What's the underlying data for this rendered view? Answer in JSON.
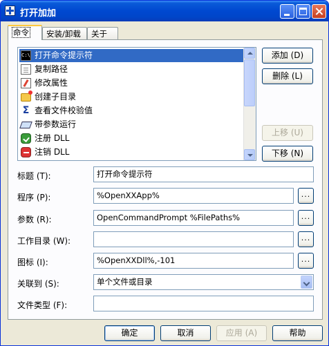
{
  "window": {
    "title": "打开加加"
  },
  "tabs": [
    {
      "label": "命令"
    },
    {
      "label": "安装/卸载"
    },
    {
      "label": "关于"
    }
  ],
  "command_list": {
    "items": [
      {
        "label": "打开命令提示符",
        "icon": "command-prompt-icon",
        "selected": true
      },
      {
        "label": "复制路径",
        "icon": "copy-path-icon"
      },
      {
        "label": "修改属性",
        "icon": "properties-icon"
      },
      {
        "label": "创建子目录",
        "icon": "new-folder-icon"
      },
      {
        "label": "查看文件校验值",
        "icon": "checksum-icon"
      },
      {
        "label": "带参数运行",
        "icon": "run-with-params-icon"
      },
      {
        "label": "注册 DLL",
        "icon": "register-dll-icon"
      },
      {
        "label": "注销 DLL",
        "icon": "unregister-dll-icon"
      }
    ]
  },
  "side_buttons": {
    "add": "添加 (D)",
    "delete": "删除 (L)",
    "move_up": "上移 (U)",
    "move_down": "下移 (N)"
  },
  "fields": {
    "title": {
      "label": "标题 (T):",
      "value": "打开命令提示符"
    },
    "program": {
      "label": "程序 (P):",
      "value": "%OpenXXApp%"
    },
    "params": {
      "label": "参数 (R):",
      "value": "OpenCommandPrompt %FilePaths%"
    },
    "workdir": {
      "label": "工作目录 (W):",
      "value": ""
    },
    "icon": {
      "label": "图标 (I):",
      "value": "%OpenXXDll%,-101"
    },
    "assoc": {
      "label": "关联到 (S):",
      "value": "单个文件或目录"
    },
    "filetype": {
      "label": "文件类型 (F):",
      "value": ""
    }
  },
  "browse_label": "...",
  "footer": {
    "ok": "确定",
    "cancel": "取消",
    "apply": "应用 (A)",
    "help": "帮助"
  },
  "colors": {
    "titlebar": "#0048d0",
    "selection": "#316ac5",
    "dialog_bg": "#ece9d8"
  }
}
